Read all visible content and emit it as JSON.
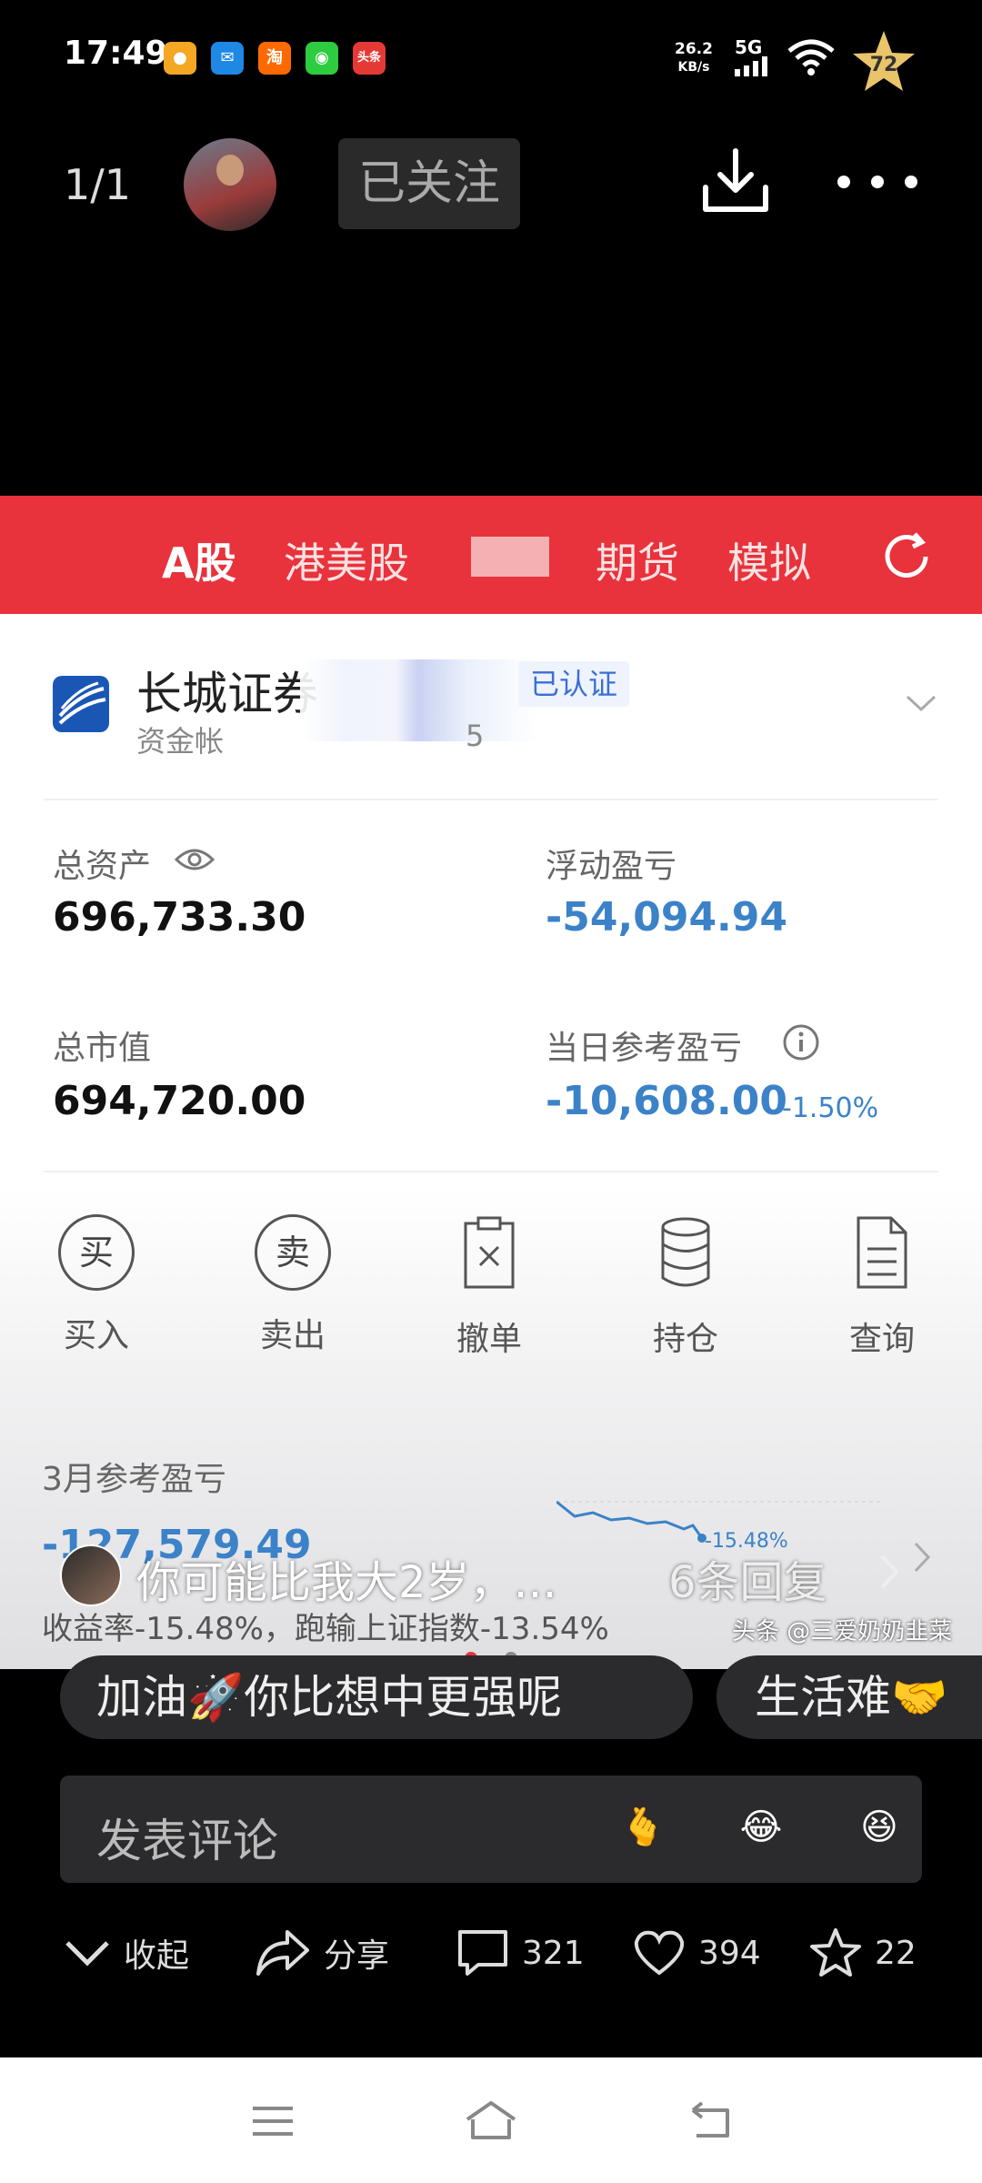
{
  "status_bar": {
    "time": "17:49",
    "apps": [
      {
        "icon": "amap-icon",
        "text": "",
        "color": "#f5a623"
      },
      {
        "icon": "message-icon",
        "text": "",
        "color": "#1e88e5"
      },
      {
        "icon": "taobao-icon",
        "text": "淘",
        "color": "#ff6a00"
      },
      {
        "icon": "wechat-icon",
        "text": "",
        "color": "#2ecc40"
      },
      {
        "icon": "toutiao-icon",
        "text": "头条",
        "color": "#e53935"
      }
    ],
    "net_speed": "26.2",
    "net_unit": "KB/s",
    "network": "5G",
    "badge": "72"
  },
  "top_bar": {
    "pager": "1/1",
    "follow_label": "已关注"
  },
  "screenshot": {
    "tabs": [
      "A股",
      "港美股",
      "期货",
      "模拟"
    ],
    "broker_name": "长城证券",
    "verify_label": "已认证",
    "account_label": "资金帐",
    "account_tail": "5",
    "total_assets_label": "总资产",
    "total_assets": "696,733.30",
    "floating_pl_label": "浮动盈亏",
    "floating_pl": "-54,094.94",
    "market_value_label": "总市值",
    "market_value": "694,720.00",
    "daily_pl_label": "当日参考盈亏",
    "daily_pl": "-10,608.00",
    "daily_pct": "-1.50%",
    "actions": [
      {
        "icon": "buy-icon",
        "glyph": "买",
        "label": "买入"
      },
      {
        "icon": "sell-icon",
        "glyph": "卖",
        "label": "卖出"
      },
      {
        "icon": "cancel-order-icon",
        "glyph": "",
        "label": "撤单"
      },
      {
        "icon": "position-icon",
        "glyph": "",
        "label": "持仓"
      },
      {
        "icon": "query-icon",
        "glyph": "",
        "label": "查询"
      }
    ],
    "month_label": "3月参考盈亏",
    "month_value": "-127,579.49",
    "month_pct": "-15.48%",
    "rate_text": "收益率-15.48%，跑输上证指数-13.54%"
  },
  "watermark": "头条 @三爱奶奶韭菜",
  "comment_preview": {
    "text": "你可能比我大2岁，…",
    "replies": "6条回复"
  },
  "quick_replies": [
    "加油🚀你比想中更强呢",
    "生活难🤝"
  ],
  "input_placeholder": "发表评论",
  "emojis": [
    "🫰",
    "😂",
    "😆"
  ],
  "bottom": {
    "collapse": "收起",
    "share": "分享",
    "comments": "321",
    "likes": "394",
    "favorites": "22"
  },
  "colors": {
    "accent_red": "#e8323c",
    "loss_blue": "#3b82c8"
  }
}
